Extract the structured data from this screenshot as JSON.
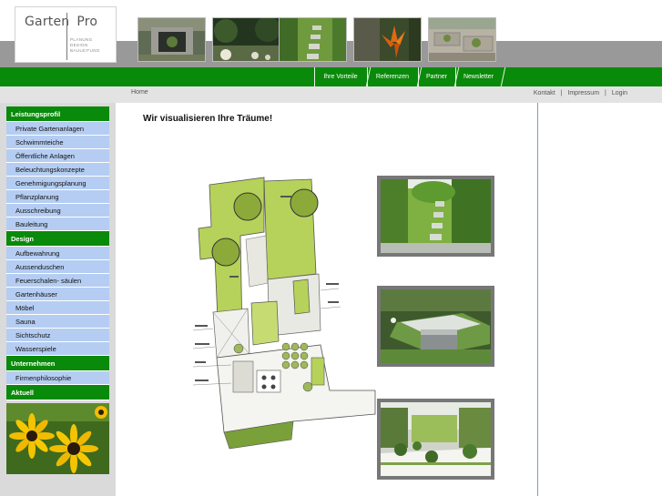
{
  "logo": {
    "name_left": "Garten",
    "name_right": "Pro",
    "taglines": [
      "PLANUNG",
      "DESIGN",
      "BAULEITUNG"
    ]
  },
  "nav": {
    "items": [
      "Ihre Vorteile",
      "Referenzen",
      "Partner",
      "Newsletter"
    ]
  },
  "breadcrumb": "Home",
  "utility_links": [
    "Kontakt",
    "Impressum",
    "Login"
  ],
  "utility_separator": "|",
  "sidebar": {
    "sections": [
      {
        "title": "Leistungsprofil",
        "items": [
          "Private Gartenanlagen",
          "Schwimmteiche",
          "Öffentliche Anlagen",
          "Beleuchtungskonzepte",
          "Genehmigungsplanung",
          "Pflanzplanung",
          "Ausschreibung",
          "Bauleitung"
        ]
      },
      {
        "title": "Design",
        "items": [
          "Aufbewahrung",
          "Aussenduschen",
          "Feuerschalen- säulen",
          "Gartenhäuser",
          "Möbel",
          "Sauna",
          "Sichtschutz",
          "Wasserspiele"
        ]
      },
      {
        "title": "Unternehmen",
        "items": [
          "Firmenphilosophie"
        ]
      },
      {
        "title": "Aktuell",
        "items": []
      }
    ]
  },
  "main": {
    "headline": "Wir visualisieren Ihre Träume!"
  },
  "colors": {
    "nav_green": "#0a8a0a",
    "menu_item_blue": "#b5cdf2",
    "band_gray": "#999999"
  }
}
